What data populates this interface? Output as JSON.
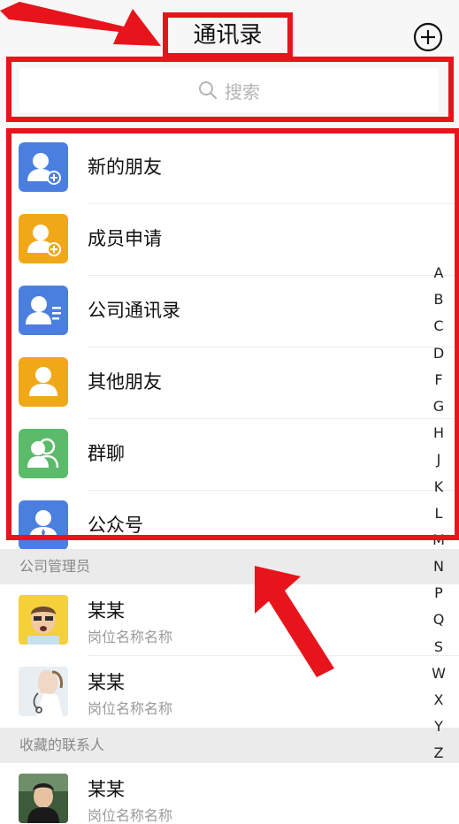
{
  "header": {
    "title": "通讯录"
  },
  "search": {
    "placeholder": "搜索"
  },
  "functions": [
    {
      "label": "新的朋友",
      "icon": "user-add-icon",
      "color": "#4a7fe0"
    },
    {
      "label": "成员申请",
      "icon": "user-add-icon",
      "color": "#f0a818"
    },
    {
      "label": "公司通讯录",
      "icon": "user-list-icon",
      "color": "#4a7fe0"
    },
    {
      "label": "其他朋友",
      "icon": "user-icon",
      "color": "#f0a818"
    },
    {
      "label": "群聊",
      "icon": "group-icon",
      "color": "#5bbb6a"
    },
    {
      "label": "公众号",
      "icon": "official-account-icon",
      "color": "#4a7fe0"
    }
  ],
  "sections": [
    {
      "title": "公司管理员",
      "contacts": [
        {
          "name": "某某",
          "role": "岗位名称名称",
          "avatar": "cartoon-avatar"
        },
        {
          "name": "某某",
          "role": "岗位名称名称",
          "avatar": "doctor-avatar"
        }
      ]
    },
    {
      "title": "收藏的联系人",
      "contacts": [
        {
          "name": "某某",
          "role": "岗位名称名称",
          "avatar": "man-avatar"
        }
      ]
    }
  ],
  "alphabet": [
    "A",
    "B",
    "C",
    "D",
    "F",
    "G",
    "H",
    "J",
    "K",
    "L",
    "M",
    "N",
    "P",
    "Q",
    "S",
    "W",
    "X",
    "Y",
    "Z"
  ],
  "colors": {
    "accent_blue": "#4a7fe0",
    "accent_orange": "#f0a818",
    "accent_green": "#5bbb6a",
    "annotation_red": "#e8141c"
  }
}
